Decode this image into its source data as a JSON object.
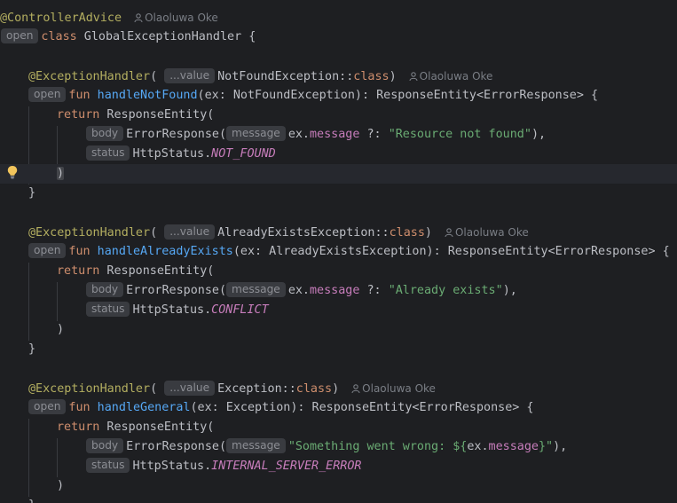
{
  "editor": {
    "author_name": "Olaoluwa Oke",
    "hints": {
      "open": "open",
      "value": "...value",
      "body": "body",
      "status": "status",
      "message": "message"
    },
    "code": {
      "l1_annotation": "@ControllerAdvice",
      "l2_class_kw": "class",
      "l2_class_name": " GlobalExceptionHandler {",
      "exception_handler": "@ExceptionHandler",
      "paren_open": "(",
      "paren_close": ")",
      "fun_kw": "fun",
      "return_kw": "return",
      "response_entity_call": " ResponseEntity(",
      "error_response_call": "ErrorResponse(",
      "ex_prefix": "ex.",
      "message_prop": "message",
      "elvis": " ?: ",
      "http_status_prefix": "HttpStatus.",
      "close_paren": ")",
      "close_brace": "}",
      "class_kw": "class",
      "double_colon": "::",
      "h1": {
        "exception_class": "NotFoundException",
        "fn_name": "handleNotFound",
        "signature": "(ex: NotFoundException): ResponseEntity<ErrorResponse> {",
        "message_string": "\"Resource not found\"",
        "after_string": "),",
        "status_const": "NOT_FOUND"
      },
      "h2": {
        "exception_class": "AlreadyExistsException",
        "fn_name": "handleAlreadyExists",
        "signature": "(ex: AlreadyExistsException): ResponseEntity<ErrorResponse> {",
        "message_string": "\"Already exists\"",
        "after_string": "),",
        "status_const": "CONFLICT"
      },
      "h3": {
        "exception_class": "Exception",
        "fn_name": "handleGeneral",
        "signature": "(ex: Exception): ResponseEntity<ErrorResponse> {",
        "template_start": "\"Something went wrong: ${",
        "template_ex": "ex.",
        "template_prop": "message",
        "template_end": "}\"",
        "after_string": "),",
        "status_const": "INTERNAL_SERVER_ERROR"
      }
    }
  },
  "colors": {
    "background": "#1e1f22",
    "annotation": "#b3ae60",
    "keyword": "#cf8e6d",
    "function": "#56a8f5",
    "property": "#c77dbb",
    "string": "#6aab73",
    "hint_bg": "#393b40"
  },
  "icons": {
    "author": "person-icon",
    "intention": "lightbulb-icon"
  }
}
